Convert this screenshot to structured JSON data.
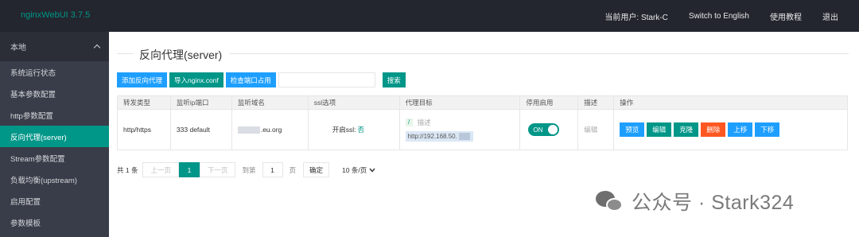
{
  "app": {
    "brand": "nginxWebUI 3.7.5"
  },
  "topnav": {
    "current_user": "当前用户: Stark-C",
    "switch_lang": "Switch to English",
    "tutorial": "使用教程",
    "logout": "退出"
  },
  "sidebar": {
    "section_label": "本地",
    "items": [
      {
        "label": "系统运行状态"
      },
      {
        "label": "基本参数配置"
      },
      {
        "label": "http参数配置"
      },
      {
        "label": "反向代理(server)"
      },
      {
        "label": "Stream参数配置"
      },
      {
        "label": "负载均衡(upstream)"
      },
      {
        "label": "启用配置"
      },
      {
        "label": "参数模板"
      }
    ],
    "active_index": 3
  },
  "page": {
    "title": "反向代理(server)"
  },
  "toolbar": {
    "add_label": "添加反向代理",
    "import_label": "导入nginx.conf",
    "check_port_label": "检查端口占用",
    "search_value": "",
    "search_button": "搜索"
  },
  "table": {
    "headers": [
      "转发类型",
      "监听ip端口",
      "监听域名",
      "ssl选项",
      "代理目标",
      "停用启用",
      "描述",
      "操作"
    ],
    "rows": [
      {
        "type": "http/https",
        "listen": "333 default",
        "domain_suffix": ".eu.org",
        "ssl_label": "开启ssl:",
        "ssl_value": "否",
        "tag": "/",
        "target_desc": "描述",
        "target_url": "http://192.168.50.",
        "toggle_label": "ON",
        "toggle_on": true,
        "edit_desc": "编辑",
        "actions": {
          "preview": "预览",
          "edit": "编辑",
          "clone": "克隆",
          "delete": "删除",
          "up": "上移",
          "down": "下移"
        }
      }
    ]
  },
  "pagination": {
    "total": "共 1 条",
    "prev": "上一页",
    "current": "1",
    "next": "下一页",
    "goto_label": "到第",
    "goto_value": "1",
    "page_unit": "页",
    "confirm": "确定",
    "page_size": "10 条/页"
  },
  "watermark": {
    "text": "公众号 · Stark324",
    "icon": "wechat-icon"
  },
  "colors": {
    "topbar": "#23262e",
    "sidebar": "#393d49",
    "accent": "#009688",
    "blue": "#1e9fff",
    "orange": "#ff5722"
  }
}
